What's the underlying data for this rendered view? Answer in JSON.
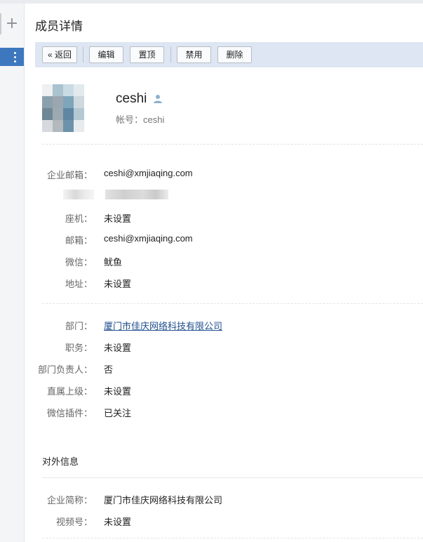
{
  "page": {
    "title": "成员详情"
  },
  "toolbar": {
    "back_label": "« 返回",
    "edit_label": "编辑",
    "pin_label": "置顶",
    "disable_label": "禁用",
    "delete_label": "删除"
  },
  "profile": {
    "name": "ceshi",
    "account": "帐号：ceshi"
  },
  "contact": {
    "corp_email": {
      "label": "企业邮箱：",
      "value": "ceshi@xmjiaqing.com"
    },
    "landline": {
      "label": "座机：",
      "value": "未设置"
    },
    "email": {
      "label": "邮箱：",
      "value": "ceshi@xmjiaqing.com"
    },
    "wechat": {
      "label": "微信：",
      "value": "鱿鱼"
    },
    "address": {
      "label": "地址：",
      "value": "未设置"
    }
  },
  "org": {
    "department": {
      "label": "部门：",
      "value": "厦门市佳庆网络科技有限公司"
    },
    "position": {
      "label": "职务：",
      "value": "未设置"
    },
    "dept_head": {
      "label": "部门负责人：",
      "value": "否"
    },
    "supervisor": {
      "label": "直属上级：",
      "value": "未设置"
    },
    "wechat_plugin": {
      "label": "微信插件：",
      "value": "已关注"
    }
  },
  "external": {
    "title": "对外信息",
    "corp_short_name": {
      "label": "企业简称：",
      "value": "厦门市佳庆网络科技有限公司"
    },
    "video_account": {
      "label": "视频号：",
      "value": "未设置"
    }
  },
  "colors": {
    "accent": "#3d78bf",
    "toolbar_bg": "#dde6f2",
    "link": "#1f4e8c"
  },
  "icons": {
    "add": "plus-icon",
    "more": "more-vertical-icon",
    "person": "person-icon"
  }
}
